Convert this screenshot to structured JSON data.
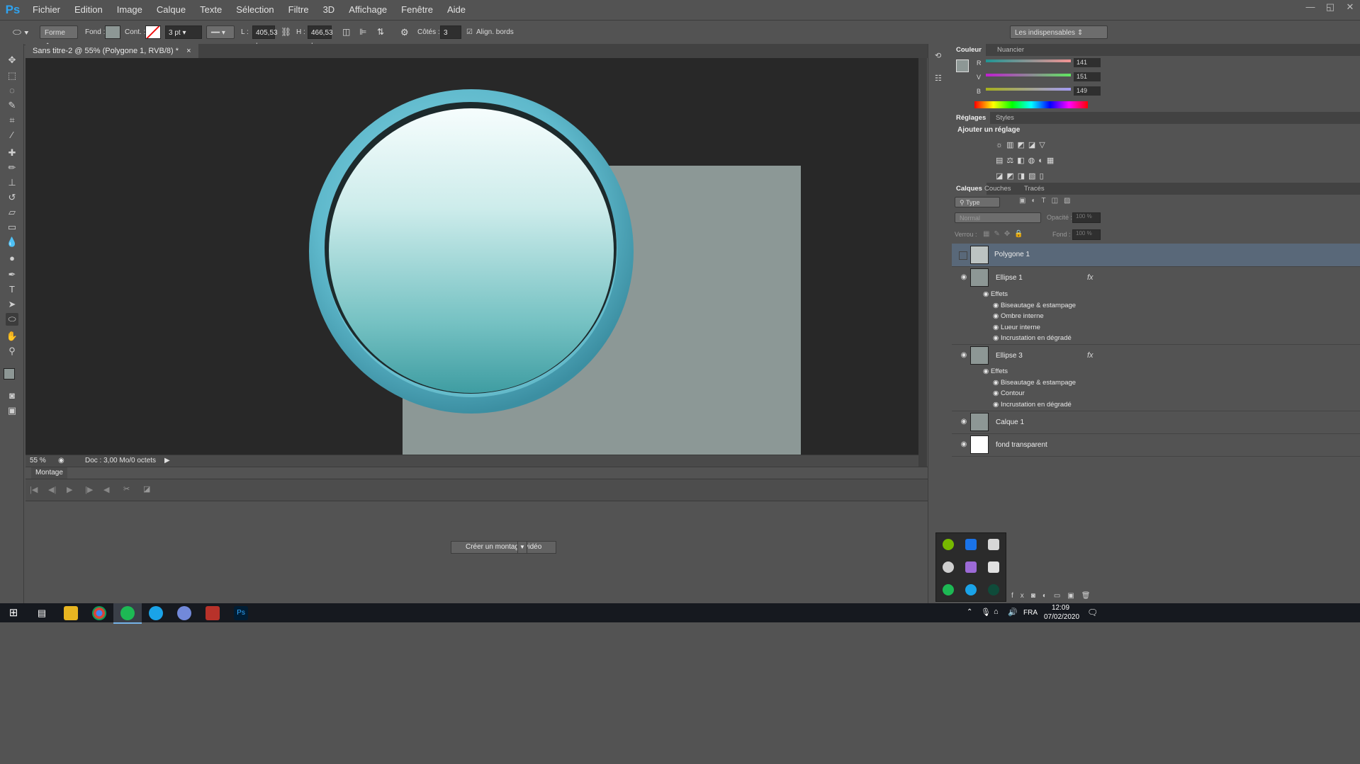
{
  "app": {
    "logo": "Ps",
    "menu": [
      "Fichier",
      "Edition",
      "Image",
      "Calque",
      "Texte",
      "Sélection",
      "Filtre",
      "3D",
      "Affichage",
      "Fenêtre",
      "Aide"
    ],
    "window_controls": [
      "—",
      "◱",
      "✕"
    ]
  },
  "options_bar": {
    "mode": "Forme",
    "fill_label": "Fond :",
    "stroke_label": "Cont. :",
    "stroke_size": "3 pt",
    "width_label": "L :",
    "width_value": "405,53 |",
    "height_label": "H :",
    "height_value": "466,53 |",
    "sides_label": "Côtés :",
    "sides_value": "3",
    "align_label": "Align. bords",
    "align_checked": true,
    "workspace": "Les indispensables"
  },
  "document": {
    "tab_title": "Sans titre-2 @ 55% (Polygone 1, RVB/8) *",
    "close_glyph": "×",
    "zoom": "55 %",
    "doc_info": "Doc : 3,00 Mo/0 octets"
  },
  "timeline": {
    "tab": "Montage",
    "create_button": "Créer un montage vidéo"
  },
  "color_panel": {
    "tabs": [
      "Couleur",
      "Nuancier"
    ],
    "channels": [
      {
        "label": "R",
        "value": "141"
      },
      {
        "label": "V",
        "value": "151"
      },
      {
        "label": "B",
        "value": "149"
      }
    ],
    "foreground": "#8d9795"
  },
  "adjustments_panel": {
    "tabs": [
      "Réglages",
      "Styles"
    ],
    "title": "Ajouter un réglage"
  },
  "layers_panel": {
    "tabs": [
      "Calques",
      "Couches",
      "Tracés"
    ],
    "filter": "Type",
    "blend_mode": "Normal",
    "opacity_label": "Opacité :",
    "opacity_value": "100 %",
    "lock_label": "Verrou :",
    "fill_label": "Fond :",
    "fill_value": "100 %",
    "layers": [
      {
        "name": "Polygone 1",
        "selected": true,
        "visible": false,
        "fx": false,
        "effects_label": "",
        "effects": []
      },
      {
        "name": "Ellipse 1",
        "selected": false,
        "visible": true,
        "fx": true,
        "effects_label": "Effets",
        "effects": [
          "Biseautage & estampage",
          "Ombre interne",
          "Lueur interne",
          "Incrustation en dégradé"
        ]
      },
      {
        "name": "Ellipse 3",
        "selected": false,
        "visible": true,
        "fx": true,
        "effects_label": "Effets",
        "effects": [
          "Biseautage & estampage",
          "Contour",
          "Incrustation en dégradé"
        ]
      },
      {
        "name": "Calque 1",
        "selected": false,
        "visible": true,
        "fx": false,
        "effects_label": "",
        "effects": []
      },
      {
        "name": "fond transparent",
        "selected": false,
        "visible": true,
        "fx": false,
        "effects_label": "",
        "effects": []
      }
    ],
    "fx_glyph": "fx"
  },
  "taskbar": {
    "language": "FRA",
    "time": "12:09",
    "date": "07/02/2020"
  }
}
